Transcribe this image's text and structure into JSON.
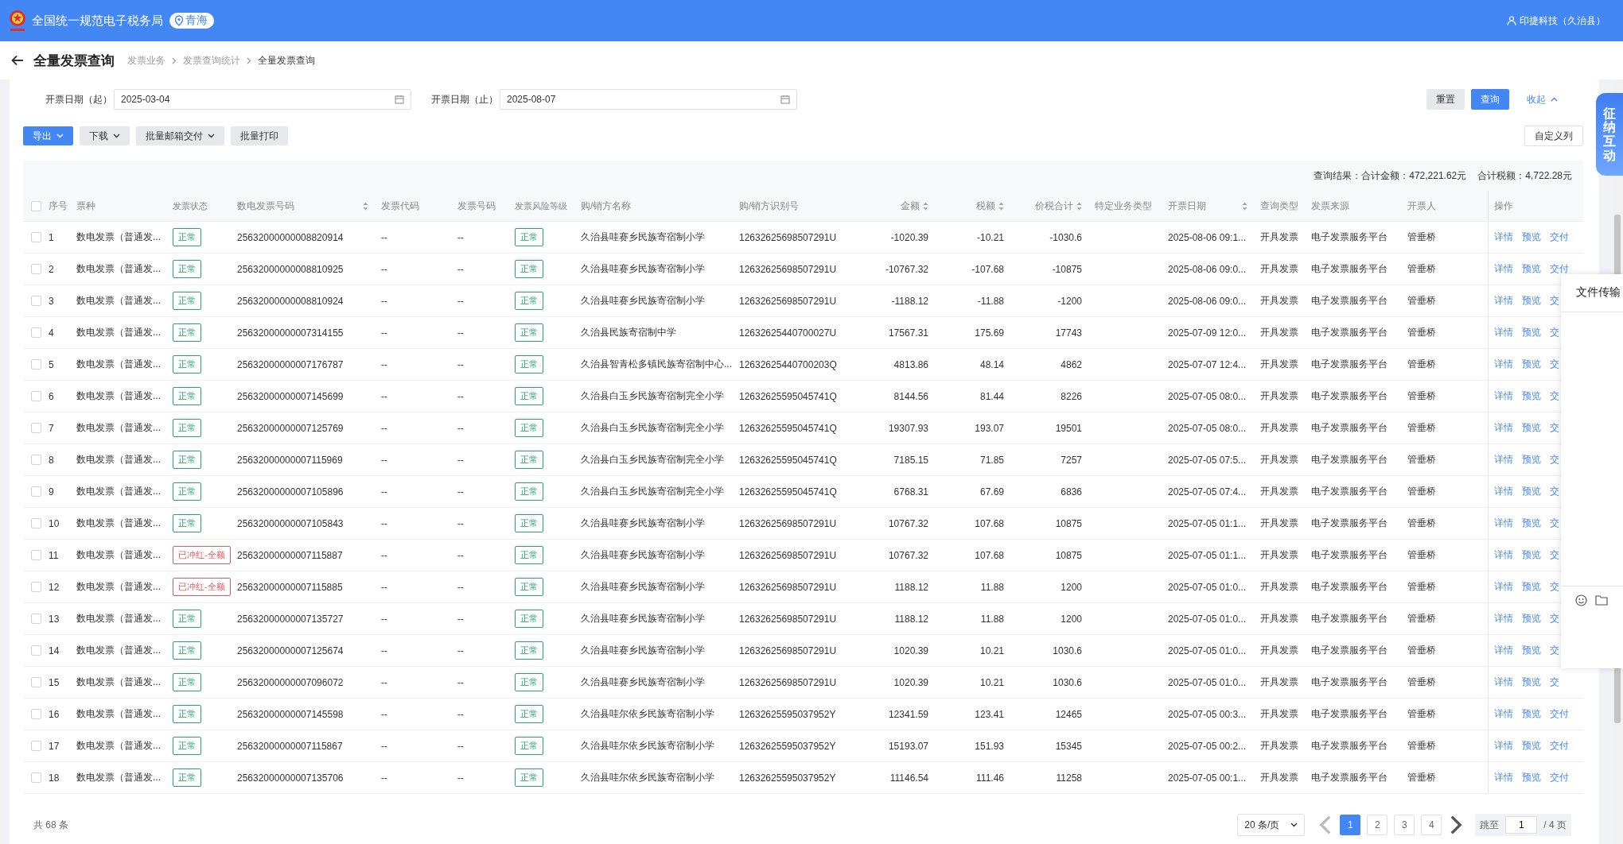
{
  "header": {
    "title": "全国统一规范电子税务局",
    "location": "青海",
    "user": "印捷科技（久治县）"
  },
  "page": {
    "title": "全量发票查询",
    "breadcrumb": [
      {
        "label": "发票业务",
        "current": false
      },
      {
        "label": "发票查询统计",
        "current": false
      },
      {
        "label": "全量发票查询",
        "current": true
      }
    ]
  },
  "filters": [
    {
      "label": "开票日期（起）",
      "value": "2025-03-04"
    },
    {
      "label": "开票日期（止）",
      "value": "2025-08-07"
    }
  ],
  "filter_buttons": [
    {
      "label": "重置",
      "kind": "secondary"
    },
    {
      "label": "查询",
      "kind": "primary"
    },
    {
      "label": "收起",
      "kind": "link"
    }
  ],
  "actions": [
    {
      "label": "导出",
      "kind": "primary",
      "dropdown": true
    },
    {
      "label": "下载",
      "kind": "secondary",
      "dropdown": true
    },
    {
      "label": "批量邮箱交付",
      "kind": "secondary",
      "dropdown": true
    },
    {
      "label": "批量打印",
      "kind": "secondary",
      "dropdown": false
    }
  ],
  "custom_columns_button": "自定义列",
  "summary": [
    "查询结果：合计金额：472,221.62元",
    "合计税额：4,722.28元"
  ],
  "table": {
    "select_all_checked": false,
    "columns": [
      {
        "label": "序号",
        "kind": "text",
        "sortable": false
      },
      {
        "label": "票种",
        "kind": "text",
        "sortable": false
      },
      {
        "label": "发票状态",
        "kind": "tag",
        "sortable": false
      },
      {
        "label": "数电发票号码",
        "kind": "text",
        "sortable": true
      },
      {
        "label": "发票代码",
        "kind": "text",
        "sortable": false
      },
      {
        "label": "发票号码",
        "kind": "text",
        "sortable": false
      },
      {
        "label": "发票风险等级",
        "kind": "tag",
        "sortable": false
      },
      {
        "label": "购/销方名称",
        "kind": "text",
        "sortable": false
      },
      {
        "label": "购/销方识别号",
        "kind": "text",
        "sortable": false
      },
      {
        "label": "金额",
        "kind": "amount",
        "sortable": true
      },
      {
        "label": "税额",
        "kind": "amount",
        "sortable": true
      },
      {
        "label": "价税合计",
        "kind": "amount",
        "sortable": true
      },
      {
        "label": "特定业务类型",
        "kind": "text",
        "sortable": false
      },
      {
        "label": "开票日期",
        "kind": "text",
        "sortable": true
      },
      {
        "label": "查询类型",
        "kind": "text",
        "sortable": false
      },
      {
        "label": "发票来源",
        "kind": "text",
        "sortable": false
      },
      {
        "label": "开票人",
        "kind": "text",
        "sortable": false
      },
      {
        "label": "操作",
        "kind": "actions",
        "sortable": false
      }
    ],
    "rows": [
      {
        "checked": false,
        "cells": [
          "1",
          "数电发票（普通发...",
          {
            "label": "正常",
            "color": "#23a866"
          },
          "25632000000008820914",
          "--",
          "--",
          {
            "label": "正常",
            "color": "#23a866"
          },
          "久治县哇赛乡民族寄宿制小学",
          "12632625698507291U",
          "-1020.39",
          "-10.21",
          "-1030.6",
          null,
          "2025-08-06 09:1...",
          "开具发票",
          "电子发票服务平台",
          "管垂桥",
          [
            "详情",
            "预览",
            "交付"
          ]
        ]
      },
      {
        "checked": false,
        "cells": [
          "2",
          "数电发票（普通发...",
          {
            "label": "正常",
            "color": "#23a866"
          },
          "25632000000008810925",
          "--",
          "--",
          {
            "label": "正常",
            "color": "#23a866"
          },
          "久治县哇赛乡民族寄宿制小学",
          "12632625698507291U",
          "-10767.32",
          "-107.68",
          "-10875",
          null,
          "2025-08-06 09:0...",
          "开具发票",
          "电子发票服务平台",
          "管垂桥",
          [
            "详情",
            "预览",
            "交付"
          ]
        ]
      },
      {
        "checked": false,
        "cells": [
          "3",
          "数电发票（普通发...",
          {
            "label": "正常",
            "color": "#23a866"
          },
          "25632000000008810924",
          "--",
          "--",
          {
            "label": "正常",
            "color": "#23a866"
          },
          "久治县哇赛乡民族寄宿制小学",
          "12632625698507291U",
          "-1188.12",
          "-11.88",
          "-1200",
          null,
          "2025-08-06 09:0...",
          "开具发票",
          "电子发票服务平台",
          "管垂桥",
          [
            "详情",
            "预览",
            "交"
          ]
        ]
      },
      {
        "checked": false,
        "cells": [
          "4",
          "数电发票（普通发...",
          {
            "label": "正常",
            "color": "#23a866"
          },
          "25632000000007314155",
          "--",
          "--",
          {
            "label": "正常",
            "color": "#23a866"
          },
          "久治县民族寄宿制中学",
          "12632625440700027U",
          "17567.31",
          "175.69",
          "17743",
          null,
          "2025-07-09 12:0...",
          "开具发票",
          "电子发票服务平台",
          "管垂桥",
          [
            "详情",
            "预览",
            "交"
          ]
        ]
      },
      {
        "checked": false,
        "cells": [
          "5",
          "数电发票（普通发...",
          {
            "label": "正常",
            "color": "#23a866"
          },
          "25632000000007176787",
          "--",
          "--",
          {
            "label": "正常",
            "color": "#23a866"
          },
          "久治县智青松多镇民族寄宿制中心...",
          "12632625440700203Q",
          "4813.86",
          "48.14",
          "4862",
          null,
          "2025-07-07 12:4...",
          "开具发票",
          "电子发票服务平台",
          "管垂桥",
          [
            "详情",
            "预览",
            "交"
          ]
        ]
      },
      {
        "checked": false,
        "cells": [
          "6",
          "数电发票（普通发...",
          {
            "label": "正常",
            "color": "#23a866"
          },
          "25632000000007145699",
          "--",
          "--",
          {
            "label": "正常",
            "color": "#23a866"
          },
          "久治县白玉乡民族寄宿制完全小学",
          "12632625595045741Q",
          "8144.56",
          "81.44",
          "8226",
          null,
          "2025-07-05 08:0...",
          "开具发票",
          "电子发票服务平台",
          "管垂桥",
          [
            "详情",
            "预览",
            "交"
          ]
        ]
      },
      {
        "checked": false,
        "cells": [
          "7",
          "数电发票（普通发...",
          {
            "label": "正常",
            "color": "#23a866"
          },
          "25632000000007125769",
          "--",
          "--",
          {
            "label": "正常",
            "color": "#23a866"
          },
          "久治县白玉乡民族寄宿制完全小学",
          "12632625595045741Q",
          "19307.93",
          "193.07",
          "19501",
          null,
          "2025-07-05 08:0...",
          "开具发票",
          "电子发票服务平台",
          "管垂桥",
          [
            "详情",
            "预览",
            "交"
          ]
        ]
      },
      {
        "checked": false,
        "cells": [
          "8",
          "数电发票（普通发...",
          {
            "label": "正常",
            "color": "#23a866"
          },
          "25632000000007115969",
          "--",
          "--",
          {
            "label": "正常",
            "color": "#23a866"
          },
          "久治县白玉乡民族寄宿制完全小学",
          "12632625595045741Q",
          "7185.15",
          "71.85",
          "7257",
          null,
          "2025-07-05 07:5...",
          "开具发票",
          "电子发票服务平台",
          "管垂桥",
          [
            "详情",
            "预览",
            "交"
          ]
        ]
      },
      {
        "checked": false,
        "cells": [
          "9",
          "数电发票（普通发...",
          {
            "label": "正常",
            "color": "#23a866"
          },
          "25632000000007105896",
          "--",
          "--",
          {
            "label": "正常",
            "color": "#23a866"
          },
          "久治县白玉乡民族寄宿制完全小学",
          "12632625595045741Q",
          "6768.31",
          "67.69",
          "6836",
          null,
          "2025-07-05 07:4...",
          "开具发票",
          "电子发票服务平台",
          "管垂桥",
          [
            "详情",
            "预览",
            "交"
          ]
        ]
      },
      {
        "checked": false,
        "cells": [
          "10",
          "数电发票（普通发...",
          {
            "label": "正常",
            "color": "#23a866"
          },
          "25632000000007105843",
          "--",
          "--",
          {
            "label": "正常",
            "color": "#23a866"
          },
          "久治县哇赛乡民族寄宿制小学",
          "12632625698507291U",
          "10767.32",
          "107.68",
          "10875",
          null,
          "2025-07-05 01:1...",
          "开具发票",
          "电子发票服务平台",
          "管垂桥",
          [
            "详情",
            "预览",
            "交"
          ]
        ]
      },
      {
        "checked": false,
        "cells": [
          "11",
          "数电发票（普通发...",
          {
            "label": "已冲红-全额",
            "color": "#f0555a"
          },
          "25632000000007115887",
          "--",
          "--",
          {
            "label": "正常",
            "color": "#23a866"
          },
          "久治县哇赛乡民族寄宿制小学",
          "12632625698507291U",
          "10767.32",
          "107.68",
          "10875",
          null,
          "2025-07-05 01:1...",
          "开具发票",
          "电子发票服务平台",
          "管垂桥",
          [
            "详情",
            "预览",
            "交"
          ]
        ]
      },
      {
        "checked": false,
        "cells": [
          "12",
          "数电发票（普通发...",
          {
            "label": "已冲红-全额",
            "color": "#f0555a"
          },
          "25632000000007115885",
          "--",
          "--",
          {
            "label": "正常",
            "color": "#23a866"
          },
          "久治县哇赛乡民族寄宿制小学",
          "12632625698507291U",
          "1188.12",
          "11.88",
          "1200",
          null,
          "2025-07-05 01:0...",
          "开具发票",
          "电子发票服务平台",
          "管垂桥",
          [
            "详情",
            "预览",
            "交"
          ]
        ]
      },
      {
        "checked": false,
        "cells": [
          "13",
          "数电发票（普通发...",
          {
            "label": "正常",
            "color": "#23a866"
          },
          "25632000000007135727",
          "--",
          "--",
          {
            "label": "正常",
            "color": "#23a866"
          },
          "久治县哇赛乡民族寄宿制小学",
          "12632625698507291U",
          "1188.12",
          "11.88",
          "1200",
          null,
          "2025-07-05 01:0...",
          "开具发票",
          "电子发票服务平台",
          "管垂桥",
          [
            "详情",
            "预览",
            "交"
          ]
        ]
      },
      {
        "checked": false,
        "cells": [
          "14",
          "数电发票（普通发...",
          {
            "label": "正常",
            "color": "#23a866"
          },
          "25632000000007125674",
          "--",
          "--",
          {
            "label": "正常",
            "color": "#23a866"
          },
          "久治县哇赛乡民族寄宿制小学",
          "12632625698507291U",
          "1020.39",
          "10.21",
          "1030.6",
          null,
          "2025-07-05 01:0...",
          "开具发票",
          "电子发票服务平台",
          "管垂桥",
          [
            "详情",
            "预览",
            "交"
          ]
        ]
      },
      {
        "checked": false,
        "cells": [
          "15",
          "数电发票（普通发...",
          {
            "label": "正常",
            "color": "#23a866"
          },
          "25632000000007096072",
          "--",
          "--",
          {
            "label": "正常",
            "color": "#23a866"
          },
          "久治县哇赛乡民族寄宿制小学",
          "12632625698507291U",
          "1020.39",
          "10.21",
          "1030.6",
          null,
          "2025-07-05 01:0...",
          "开具发票",
          "电子发票服务平台",
          "管垂桥",
          [
            "详情",
            "预览",
            "交"
          ]
        ]
      },
      {
        "checked": false,
        "cells": [
          "16",
          "数电发票（普通发...",
          {
            "label": "正常",
            "color": "#23a866"
          },
          "25632000000007145598",
          "--",
          "--",
          {
            "label": "正常",
            "color": "#23a866"
          },
          "久治县哇尔依乡民族寄宿制小学",
          "12632625595037952Y",
          "12341.59",
          "123.41",
          "12465",
          null,
          "2025-07-05 00:3...",
          "开具发票",
          "电子发票服务平台",
          "管垂桥",
          [
            "详情",
            "预览",
            "交付"
          ]
        ]
      },
      {
        "checked": false,
        "cells": [
          "17",
          "数电发票（普通发...",
          {
            "label": "正常",
            "color": "#23a866"
          },
          "25632000000007115867",
          "--",
          "--",
          {
            "label": "正常",
            "color": "#23a866"
          },
          "久治县哇尔依乡民族寄宿制小学",
          "12632625595037952Y",
          "15193.07",
          "151.93",
          "15345",
          null,
          "2025-07-05 00:2...",
          "开具发票",
          "电子发票服务平台",
          "管垂桥",
          [
            "详情",
            "预览",
            "交付"
          ]
        ]
      },
      {
        "checked": false,
        "cells": [
          "18",
          "数电发票（普通发...",
          {
            "label": "正常",
            "color": "#23a866"
          },
          "25632000000007135706",
          "--",
          "--",
          {
            "label": "正常",
            "color": "#23a866"
          },
          "久治县哇尔依乡民族寄宿制小学",
          "12632625595037952Y",
          "11146.54",
          "111.46",
          "11258",
          null,
          "2025-07-05 00:1...",
          "开具发票",
          "电子发票服务平台",
          "管垂桥",
          [
            "详情",
            "预览",
            "交付"
          ]
        ]
      }
    ]
  },
  "pagination": {
    "total": "共 68 条",
    "page_size": "20 条/页",
    "pages": [
      {
        "label": "1",
        "selected": true
      },
      {
        "label": "2",
        "selected": false
      },
      {
        "label": "3",
        "selected": false
      },
      {
        "label": "4",
        "selected": false
      }
    ],
    "jump_label": "跳至",
    "jump_value": "1",
    "page_count": "/ 4 页"
  },
  "side_tab": "征纳互动",
  "file_panel": {
    "title": "文件传输"
  }
}
